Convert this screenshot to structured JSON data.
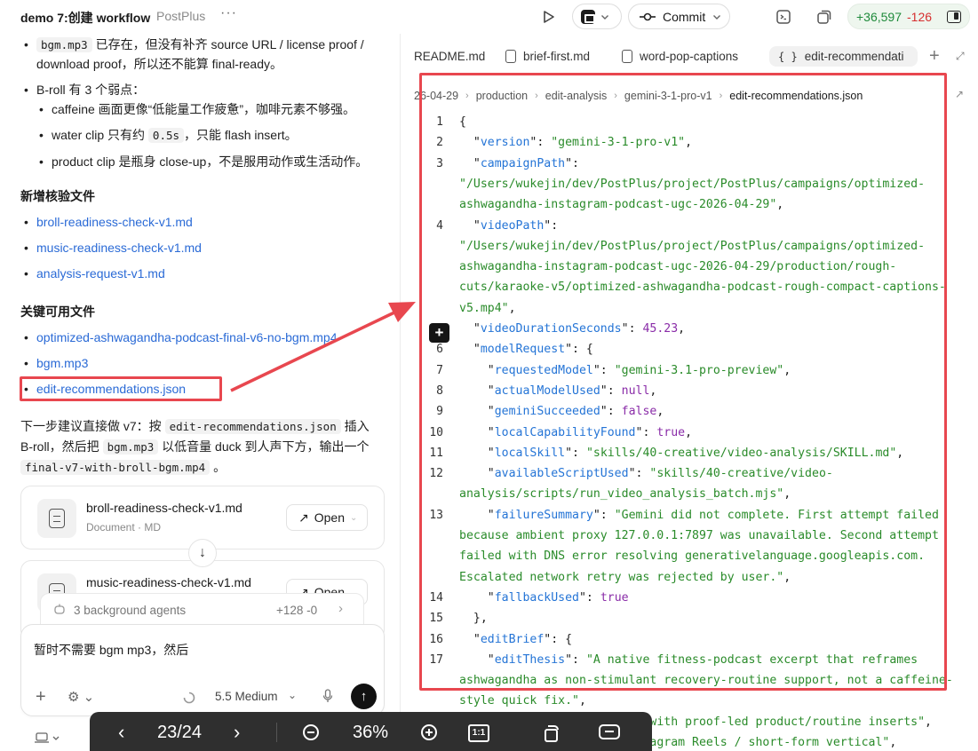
{
  "app": {
    "title": "demo 7:创建 workflow",
    "subtitle": "PostPlus",
    "more": "···"
  },
  "toolbar": {
    "commit_label": "Commit",
    "diff_added": "+36,597",
    "diff_removed": "-126"
  },
  "chat": {
    "frag_line1_code": "bgm.mp3",
    "frag_line1_text": "已存在，但没有补齐 source URL / license proof /",
    "frag_line2": "download proof，所以还不能算 final-ready。",
    "broll_heading": "B-roll 有 3 个弱点：",
    "broll_points": [
      "caffeine 画面更像“低能量工作疲惫”，咖啡元素不够强。",
      "water clip 只有约 ",
      "，只能 flash insert。",
      "product clip 是瓶身 close-up，不是服用动作或生活动作。"
    ],
    "water_code": "0.5s",
    "new_files_heading": "新增核验文件",
    "new_files": [
      "broll-readiness-check-v1.md",
      "music-readiness-check-v1.md",
      "analysis-request-v1.md"
    ],
    "key_files_heading": "关键可用文件",
    "key_files": [
      "optimized-ashwagandha-podcast-final-v6-no-bgm.mp4",
      "bgm.mp3",
      "edit-recommendations.json"
    ],
    "next_step": {
      "t1": "下一步建议直接做 v7：按 ",
      "c1": "edit-recommendations.json",
      "t2": " 插入",
      "t3": "B-roll，然后把 ",
      "c2": "bgm.mp3",
      "t4": " 以低音量 duck 到人声下方，输出一个",
      "c3": "final-v7-with-broll-bgm.mp4",
      "t5": " 。"
    },
    "cards": [
      {
        "title": "broll-readiness-check-v1.md",
        "subtitle": "Document · MD",
        "action": "Open"
      },
      {
        "title": "music-readiness-check-v1.md",
        "subtitle": "",
        "action": "Open"
      }
    ],
    "agents_bar": {
      "label": "3 background agents",
      "diff": "+128 -0"
    },
    "composer": {
      "text": "暂时不需要 bgm mp3，然后",
      "model": "5.5 Medium"
    }
  },
  "editor": {
    "tabs": [
      "README.md",
      "brief-first.md",
      "word-pop-captions",
      "edit-recommendati"
    ],
    "breadcrumbs": [
      "26-04-29",
      "production",
      "edit-analysis",
      "gemini-3-1-pro-v1",
      "edit-recommendations.json"
    ],
    "lines": [
      {
        "n": "1",
        "tokens": [
          [
            "p",
            "{"
          ]
        ]
      },
      {
        "n": "2",
        "tokens": [
          [
            "p",
            "  \""
          ],
          [
            "k",
            "version"
          ],
          [
            "p",
            "\": "
          ],
          [
            "s",
            "\"gemini-3-1-pro-v1\""
          ],
          [
            "p",
            ","
          ]
        ]
      },
      {
        "n": "3",
        "tokens": [
          [
            "p",
            "  \""
          ],
          [
            "k",
            "campaignPath"
          ],
          [
            "p",
            "\":"
          ]
        ]
      },
      {
        "n": "",
        "tokens": [
          [
            "s",
            "\"/Users/wukejin/dev/PostPlus/project/PostPlus/campaigns/optimized-"
          ]
        ]
      },
      {
        "n": "",
        "tokens": [
          [
            "s",
            "ashwagandha-instagram-podcast-ugc-2026-04-29\""
          ],
          [
            "p",
            ","
          ]
        ]
      },
      {
        "n": "4",
        "tokens": [
          [
            "p",
            "  \""
          ],
          [
            "k",
            "videoPath"
          ],
          [
            "p",
            "\":"
          ]
        ]
      },
      {
        "n": "",
        "tokens": [
          [
            "s",
            "\"/Users/wukejin/dev/PostPlus/project/PostPlus/campaigns/optimized-"
          ]
        ]
      },
      {
        "n": "",
        "tokens": [
          [
            "s",
            "ashwagandha-instagram-podcast-ugc-2026-04-29/production/rough-"
          ]
        ]
      },
      {
        "n": "",
        "tokens": [
          [
            "s",
            "cuts/karaoke-v5/optimized-ashwagandha-podcast-rough-compact-captions-"
          ]
        ]
      },
      {
        "n": "",
        "tokens": [
          [
            "s",
            "v5.mp4\""
          ],
          [
            "p",
            ","
          ]
        ]
      },
      {
        "n": "",
        "tokens": [
          [
            "p",
            "  \""
          ],
          [
            "k",
            "videoDurationSeconds"
          ],
          [
            "p",
            "\": "
          ],
          [
            "n",
            "45.23"
          ],
          [
            "p",
            ","
          ]
        ]
      },
      {
        "n": "6",
        "tokens": [
          [
            "p",
            "  \""
          ],
          [
            "k",
            "modelRequest"
          ],
          [
            "p",
            "\": {"
          ]
        ]
      },
      {
        "n": "7",
        "tokens": [
          [
            "p",
            "    \""
          ],
          [
            "k",
            "requestedModel"
          ],
          [
            "p",
            "\": "
          ],
          [
            "s",
            "\"gemini-3.1-pro-preview\""
          ],
          [
            "p",
            ","
          ]
        ]
      },
      {
        "n": "8",
        "tokens": [
          [
            "p",
            "    \""
          ],
          [
            "k",
            "actualModelUsed"
          ],
          [
            "p",
            "\": "
          ],
          [
            "n",
            "null"
          ],
          [
            "p",
            ","
          ]
        ]
      },
      {
        "n": "9",
        "tokens": [
          [
            "p",
            "    \""
          ],
          [
            "k",
            "geminiSucceeded"
          ],
          [
            "p",
            "\": "
          ],
          [
            "n",
            "false"
          ],
          [
            "p",
            ","
          ]
        ]
      },
      {
        "n": "10",
        "tokens": [
          [
            "p",
            "    \""
          ],
          [
            "k",
            "localCapabilityFound"
          ],
          [
            "p",
            "\": "
          ],
          [
            "n",
            "true"
          ],
          [
            "p",
            ","
          ]
        ]
      },
      {
        "n": "11",
        "tokens": [
          [
            "p",
            "    \""
          ],
          [
            "k",
            "localSkill"
          ],
          [
            "p",
            "\": "
          ],
          [
            "s",
            "\"skills/40-creative/video-analysis/SKILL.md\""
          ],
          [
            "p",
            ","
          ]
        ]
      },
      {
        "n": "12",
        "tokens": [
          [
            "p",
            "    \""
          ],
          [
            "k",
            "availableScriptUsed"
          ],
          [
            "p",
            "\": "
          ],
          [
            "s",
            "\"skills/40-creative/video-"
          ]
        ]
      },
      {
        "n": "",
        "tokens": [
          [
            "s",
            "analysis/scripts/run_video_analysis_batch.mjs\""
          ],
          [
            "p",
            ","
          ]
        ]
      },
      {
        "n": "13",
        "tokens": [
          [
            "p",
            "    \""
          ],
          [
            "k",
            "failureSummary"
          ],
          [
            "p",
            "\": "
          ],
          [
            "s",
            "\"Gemini did not complete. First attempt failed"
          ]
        ]
      },
      {
        "n": "",
        "tokens": [
          [
            "s",
            "because ambient proxy 127.0.0.1:7897 was unavailable. Second attempt"
          ]
        ]
      },
      {
        "n": "",
        "tokens": [
          [
            "s",
            "failed with DNS error resolving generativelanguage.googleapis.com."
          ]
        ]
      },
      {
        "n": "",
        "tokens": [
          [
            "s",
            "Escalated network retry was rejected by user.\""
          ],
          [
            "p",
            ","
          ]
        ]
      },
      {
        "n": "14",
        "tokens": [
          [
            "p",
            "    \""
          ],
          [
            "k",
            "fallbackUsed"
          ],
          [
            "p",
            "\": "
          ],
          [
            "n",
            "true"
          ]
        ]
      },
      {
        "n": "15",
        "tokens": [
          [
            "p",
            "  },"
          ]
        ]
      },
      {
        "n": "16",
        "tokens": [
          [
            "p",
            "  \""
          ],
          [
            "k",
            "editBrief"
          ],
          [
            "p",
            "\": {"
          ]
        ]
      },
      {
        "n": "17",
        "tokens": [
          [
            "p",
            "    \""
          ],
          [
            "k",
            "editThesis"
          ],
          [
            "p",
            "\": "
          ],
          [
            "s",
            "\"A native fitness-podcast excerpt that reframes"
          ]
        ]
      },
      {
        "n": "",
        "tokens": [
          [
            "s",
            "ashwagandha as non-stimulant recovery-routine support, not a caffeine-"
          ]
        ]
      },
      {
        "n": "",
        "tokens": [
          [
            "s",
            "style quick fix.\""
          ],
          [
            "p",
            ","
          ]
        ]
      },
      {
        "n": "18",
        "tokens": [
          [
            "p",
            "    \""
          ],
          [
            "k",
            "mode"
          ],
          [
            "p",
            "\": "
          ],
          [
            "s",
            "\"viewpoint-led with proof-led product/routine inserts\""
          ],
          [
            "p",
            ","
          ]
        ]
      },
      {
        "n": "19",
        "tokens": [
          [
            "p",
            "    \""
          ],
          [
            "k",
            "targetPlatform"
          ],
          [
            "p",
            "\": "
          ],
          [
            "s",
            "\"Instagram Reels / short-form vertical\""
          ],
          [
            "p",
            ","
          ]
        ]
      }
    ]
  },
  "viewer": {
    "page": "23/24",
    "zoom": "36%",
    "fit": "1:1"
  }
}
